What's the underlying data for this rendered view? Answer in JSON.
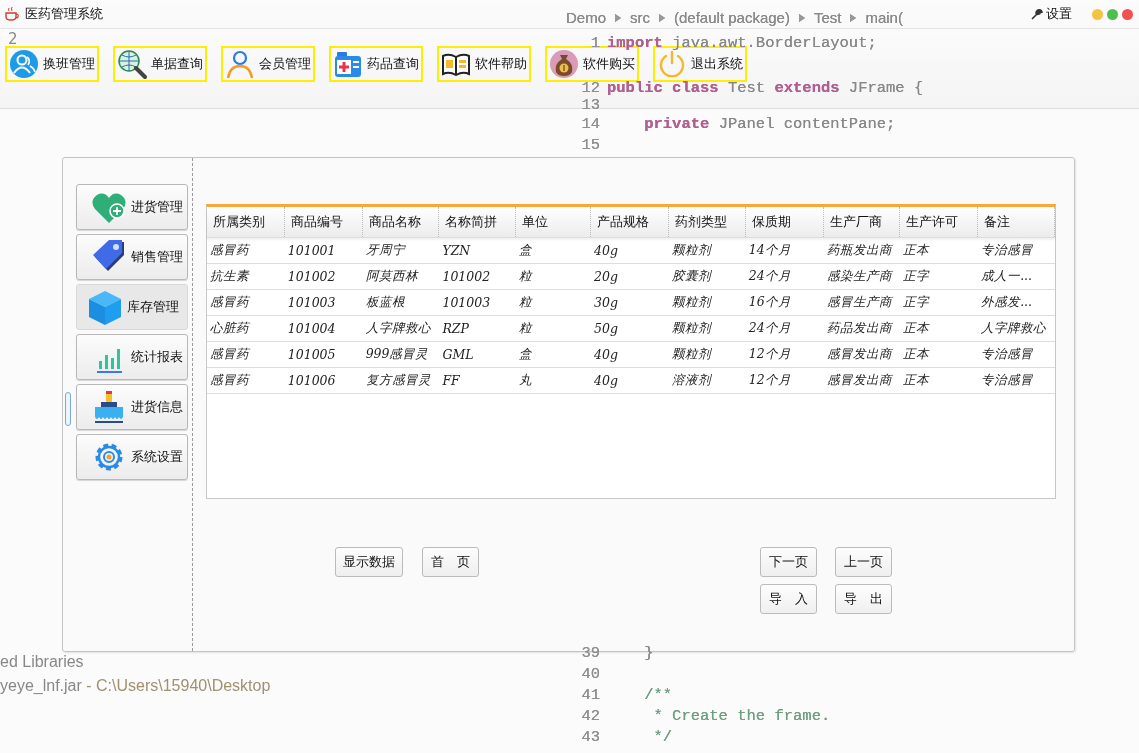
{
  "window": {
    "title": "医药管理系统",
    "settings_label": "设置"
  },
  "ide": {
    "breadcrumb": [
      "Demo",
      "src",
      "(default package)",
      "Test",
      "main("
    ],
    "tree_fragment": "2",
    "top_lines": [
      {
        "number": "1",
        "code": "**import** java.awt.BorderLayout;"
      },
      {
        "number": "12",
        "code": "**public class** Test **extends** JFrame {"
      },
      {
        "number": "13"
      },
      {
        "number": "14",
        "code": "    **private** JPanel contentPane;"
      },
      {
        "number": "15"
      }
    ],
    "bottom_lines": [
      {
        "number": "39",
        "code": "    }"
      },
      {
        "number": "40"
      },
      {
        "number": "41",
        "code": "    /**",
        "kind": "comment"
      },
      {
        "number": "42",
        "code": "     * Create the frame.",
        "kind": "comment"
      },
      {
        "number": "43",
        "code": "     */",
        "kind": "comment"
      }
    ],
    "tree_bottom": [
      {
        "name": "ed Libraries"
      },
      {
        "name": "yeye_lnf.jar",
        "path": " - C:\\Users\\15940\\Desktop"
      }
    ]
  },
  "toolbar": [
    {
      "label": "换班管理"
    },
    {
      "label": "单据查询"
    },
    {
      "label": "会员管理"
    },
    {
      "label": "药品查询"
    },
    {
      "label": "软件帮助"
    },
    {
      "label": "软件购买"
    },
    {
      "label": "退出系统"
    }
  ],
  "sidebar": [
    {
      "label": "进货管理",
      "selected": false
    },
    {
      "label": "销售管理",
      "selected": false
    },
    {
      "label": "库存管理",
      "selected": true
    },
    {
      "label": "统计报表",
      "selected": false
    },
    {
      "label": "进货信息",
      "selected": false
    },
    {
      "label": "系统设置",
      "selected": false
    }
  ],
  "table": {
    "columns": [
      "所属类别",
      "商品编号",
      "商品名称",
      "名称简拼",
      "单位",
      "产品规格",
      "药剂类型",
      "保质期",
      "生产厂商",
      "生产许可",
      "备注"
    ],
    "rows": [
      [
        "感冒药",
        "101001",
        "牙周宁",
        "YZN",
        "盒",
        "40g",
        "颗粒剂",
        "14个月",
        "药瓶发出商",
        "正本",
        "专治感冒"
      ],
      [
        "抗生素",
        "101002",
        "阿莫西林",
        "101002",
        "粒",
        "20g",
        "胶囊剂",
        "24个月",
        "感染生产商",
        "正字",
        "成人一..."
      ],
      [
        "感冒药",
        "101003",
        "板蓝根",
        "101003",
        "粒",
        "30g",
        "颗粒剂",
        "16个月",
        "感冒生产商",
        "正字",
        "外感发..."
      ],
      [
        "心脏药",
        "101004",
        "人字牌救心",
        "RZP",
        "粒",
        "50g",
        "颗粒剂",
        "24个月",
        "药品发出商",
        "正本",
        "人字牌救心"
      ],
      [
        "感冒药",
        "101005",
        "999感冒灵",
        "GML",
        "盒",
        "40g",
        "颗粒剂",
        "12个月",
        "感冒发出商",
        "正本",
        "专治感冒"
      ],
      [
        "感冒药",
        "101006",
        "复方感冒灵",
        "FF",
        "丸",
        "40g",
        "溶液剂",
        "12个月",
        "感冒发出商",
        "正本",
        "专治感冒"
      ]
    ]
  },
  "left_buttons": [
    "显示数据",
    "首 页"
  ],
  "right_buttons": [
    [
      "下一页",
      "上一页"
    ],
    [
      "导 入",
      "导 出"
    ]
  ]
}
